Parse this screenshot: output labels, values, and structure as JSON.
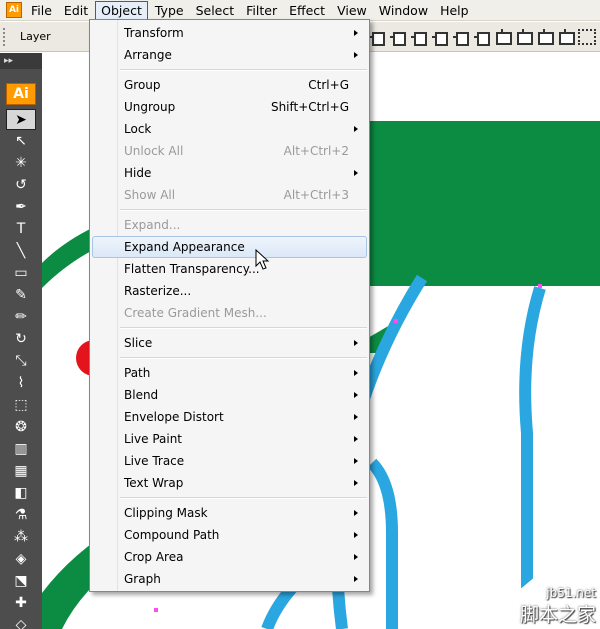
{
  "menubar": {
    "items": [
      "File",
      "Edit",
      "Object",
      "Type",
      "Select",
      "Filter",
      "Effect",
      "View",
      "Window",
      "Help"
    ],
    "active": "Object"
  },
  "controlbar": {
    "layer_label": "Layer"
  },
  "toolbox": {
    "logo": "Ai"
  },
  "object_menu": {
    "transform": "Transform",
    "arrange": "Arrange",
    "group": "Group",
    "group_sc": "Ctrl+G",
    "ungroup": "Ungroup",
    "ungroup_sc": "Shift+Ctrl+G",
    "lock": "Lock",
    "unlock_all": "Unlock All",
    "unlock_all_sc": "Alt+Ctrl+2",
    "hide": "Hide",
    "show_all": "Show All",
    "show_all_sc": "Alt+Ctrl+3",
    "expand": "Expand...",
    "expand_appearance": "Expand Appearance",
    "flatten_transparency": "Flatten Transparency...",
    "rasterize": "Rasterize...",
    "create_gradient_mesh": "Create Gradient Mesh...",
    "slice": "Slice",
    "path": "Path",
    "blend": "Blend",
    "envelope_distort": "Envelope Distort",
    "live_paint": "Live Paint",
    "live_trace": "Live Trace",
    "text_wrap": "Text Wrap",
    "clipping_mask": "Clipping Mask",
    "compound_path": "Compound Path",
    "crop_area": "Crop Area",
    "graph": "Graph"
  },
  "watermark": {
    "line1": "jb51.net",
    "line2": "脚本之家"
  },
  "colors": {
    "green": "#0b8c42",
    "blue": "#2aa6e0",
    "red": "#e3141b",
    "toolbox": "#4d4d4d"
  }
}
